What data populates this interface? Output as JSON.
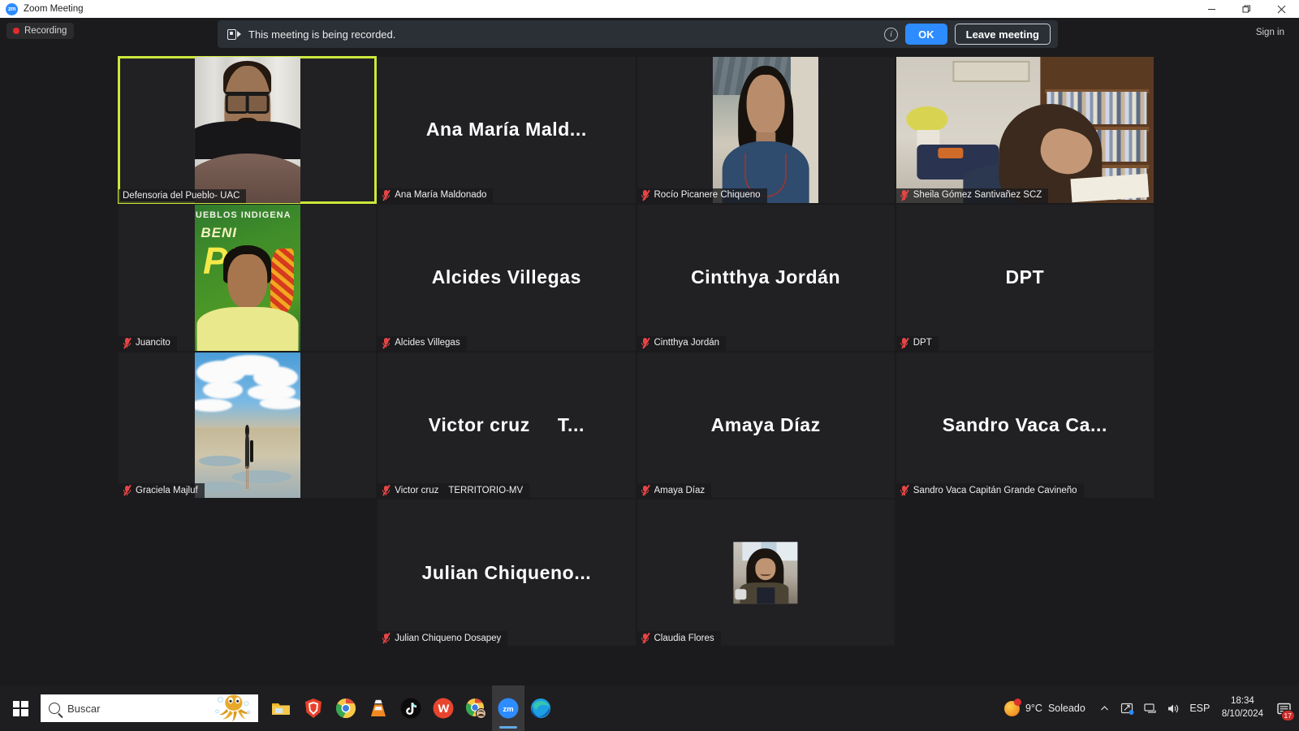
{
  "window": {
    "title": "Zoom Meeting",
    "app_logo_text": "zm",
    "controls": {
      "minimize": "—",
      "maximize": "❐",
      "close": "✕"
    }
  },
  "topbar": {
    "recording_label": "Recording",
    "banner_text": "This meeting is being recorded.",
    "info_icon": "info-icon",
    "ok_label": "OK",
    "leave_label": "Leave meeting",
    "signin_label": "Sign in",
    "accent_blue": "#2d8cff",
    "recording_red": "#e02b2b"
  },
  "grid": {
    "active_border_color": "#cbe83b",
    "rows": 4,
    "cols": 4,
    "tiles": [
      {
        "name": "Defensoria del Pueblo- UAC",
        "display": "",
        "video": true,
        "scene": "defensoria",
        "muted": false,
        "active": true,
        "feed": "narrow"
      },
      {
        "name": "Ana María Maldonado",
        "display": "Ana María Mald...",
        "video": false,
        "muted": true
      },
      {
        "name": "Rocío Picanere Chiqueno",
        "display": "",
        "video": true,
        "scene": "rocio",
        "muted": true,
        "feed": "narrow"
      },
      {
        "name": "Sheila Gómez Santivañez SCZ",
        "display": "",
        "video": true,
        "scene": "sheila",
        "muted": true,
        "feed": "wide"
      },
      {
        "name": "Juancito",
        "display": "",
        "video": true,
        "scene": "juancito",
        "muted": true,
        "feed": "narrow"
      },
      {
        "name": "Alcides Villegas",
        "display": "Alcides Villegas",
        "video": false,
        "muted": true
      },
      {
        "name": "Cintthya Jordán",
        "display": "Cintthya Jordán",
        "video": false,
        "muted": true
      },
      {
        "name": "DPT",
        "display": "DPT",
        "video": false,
        "muted": true
      },
      {
        "name": "Graciela Majluf",
        "display": "",
        "video": true,
        "scene": "graciela",
        "muted": true,
        "feed": "narrow"
      },
      {
        "name_part1": "Victor cruz",
        "name_part2": "TERRITORIO-MV",
        "name": "Victor cruz  TERRITORIO-MV",
        "display_part1": "Victor cruz",
        "display_part2": "T...",
        "video": false,
        "muted": true,
        "split": true
      },
      {
        "name": "Amaya Díaz",
        "display": "Amaya Díaz",
        "video": false,
        "muted": true
      },
      {
        "name": "Sandro Vaca Capitán Grande Cavineño",
        "display": "Sandro Vaca Ca...",
        "video": false,
        "muted": true
      },
      {
        "empty": true
      },
      {
        "name": "Julian Chiqueno Dosapey",
        "display": "Julian Chiqueno...",
        "video": false,
        "muted": true
      },
      {
        "name": "Claudia Flores",
        "display": "",
        "video": true,
        "scene": "claudia",
        "muted": true,
        "feed": "thumb"
      },
      {
        "empty": true
      }
    ]
  },
  "taskbar": {
    "start_label": "start-button",
    "search_placeholder": "Buscar",
    "apps": [
      {
        "name": "file-explorer",
        "running": false
      },
      {
        "name": "brave-browser",
        "running": true
      },
      {
        "name": "google-chrome",
        "running": true
      },
      {
        "name": "vlc-media-player",
        "running": false
      },
      {
        "name": "tiktok",
        "running": false
      },
      {
        "name": "wps-office",
        "running": false
      },
      {
        "name": "google-chrome-profile",
        "running": true
      },
      {
        "name": "zoom",
        "running": true,
        "active": true
      },
      {
        "name": "microsoft-edge",
        "running": true
      }
    ],
    "weather": {
      "temperature": "9°C",
      "condition": "Soleado"
    },
    "language": "ESP",
    "time": "18:34",
    "date": "8/10/2024",
    "notification_count": "17"
  }
}
